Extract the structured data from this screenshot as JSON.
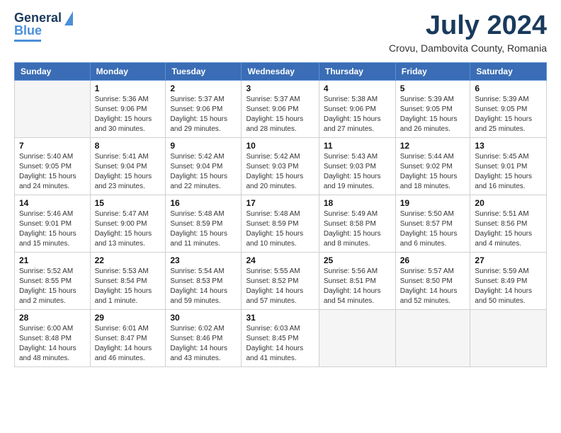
{
  "logo": {
    "line1": "General",
    "line2": "Blue"
  },
  "title": "July 2024",
  "subtitle": "Crovu, Dambovita County, Romania",
  "weekdays": [
    "Sunday",
    "Monday",
    "Tuesday",
    "Wednesday",
    "Thursday",
    "Friday",
    "Saturday"
  ],
  "weeks": [
    [
      {
        "day": "",
        "info": ""
      },
      {
        "day": "1",
        "info": "Sunrise: 5:36 AM\nSunset: 9:06 PM\nDaylight: 15 hours\nand 30 minutes."
      },
      {
        "day": "2",
        "info": "Sunrise: 5:37 AM\nSunset: 9:06 PM\nDaylight: 15 hours\nand 29 minutes."
      },
      {
        "day": "3",
        "info": "Sunrise: 5:37 AM\nSunset: 9:06 PM\nDaylight: 15 hours\nand 28 minutes."
      },
      {
        "day": "4",
        "info": "Sunrise: 5:38 AM\nSunset: 9:06 PM\nDaylight: 15 hours\nand 27 minutes."
      },
      {
        "day": "5",
        "info": "Sunrise: 5:39 AM\nSunset: 9:05 PM\nDaylight: 15 hours\nand 26 minutes."
      },
      {
        "day": "6",
        "info": "Sunrise: 5:39 AM\nSunset: 9:05 PM\nDaylight: 15 hours\nand 25 minutes."
      }
    ],
    [
      {
        "day": "7",
        "info": "Sunrise: 5:40 AM\nSunset: 9:05 PM\nDaylight: 15 hours\nand 24 minutes."
      },
      {
        "day": "8",
        "info": "Sunrise: 5:41 AM\nSunset: 9:04 PM\nDaylight: 15 hours\nand 23 minutes."
      },
      {
        "day": "9",
        "info": "Sunrise: 5:42 AM\nSunset: 9:04 PM\nDaylight: 15 hours\nand 22 minutes."
      },
      {
        "day": "10",
        "info": "Sunrise: 5:42 AM\nSunset: 9:03 PM\nDaylight: 15 hours\nand 20 minutes."
      },
      {
        "day": "11",
        "info": "Sunrise: 5:43 AM\nSunset: 9:03 PM\nDaylight: 15 hours\nand 19 minutes."
      },
      {
        "day": "12",
        "info": "Sunrise: 5:44 AM\nSunset: 9:02 PM\nDaylight: 15 hours\nand 18 minutes."
      },
      {
        "day": "13",
        "info": "Sunrise: 5:45 AM\nSunset: 9:01 PM\nDaylight: 15 hours\nand 16 minutes."
      }
    ],
    [
      {
        "day": "14",
        "info": "Sunrise: 5:46 AM\nSunset: 9:01 PM\nDaylight: 15 hours\nand 15 minutes."
      },
      {
        "day": "15",
        "info": "Sunrise: 5:47 AM\nSunset: 9:00 PM\nDaylight: 15 hours\nand 13 minutes."
      },
      {
        "day": "16",
        "info": "Sunrise: 5:48 AM\nSunset: 8:59 PM\nDaylight: 15 hours\nand 11 minutes."
      },
      {
        "day": "17",
        "info": "Sunrise: 5:48 AM\nSunset: 8:59 PM\nDaylight: 15 hours\nand 10 minutes."
      },
      {
        "day": "18",
        "info": "Sunrise: 5:49 AM\nSunset: 8:58 PM\nDaylight: 15 hours\nand 8 minutes."
      },
      {
        "day": "19",
        "info": "Sunrise: 5:50 AM\nSunset: 8:57 PM\nDaylight: 15 hours\nand 6 minutes."
      },
      {
        "day": "20",
        "info": "Sunrise: 5:51 AM\nSunset: 8:56 PM\nDaylight: 15 hours\nand 4 minutes."
      }
    ],
    [
      {
        "day": "21",
        "info": "Sunrise: 5:52 AM\nSunset: 8:55 PM\nDaylight: 15 hours\nand 2 minutes."
      },
      {
        "day": "22",
        "info": "Sunrise: 5:53 AM\nSunset: 8:54 PM\nDaylight: 15 hours\nand 1 minute."
      },
      {
        "day": "23",
        "info": "Sunrise: 5:54 AM\nSunset: 8:53 PM\nDaylight: 14 hours\nand 59 minutes."
      },
      {
        "day": "24",
        "info": "Sunrise: 5:55 AM\nSunset: 8:52 PM\nDaylight: 14 hours\nand 57 minutes."
      },
      {
        "day": "25",
        "info": "Sunrise: 5:56 AM\nSunset: 8:51 PM\nDaylight: 14 hours\nand 54 minutes."
      },
      {
        "day": "26",
        "info": "Sunrise: 5:57 AM\nSunset: 8:50 PM\nDaylight: 14 hours\nand 52 minutes."
      },
      {
        "day": "27",
        "info": "Sunrise: 5:59 AM\nSunset: 8:49 PM\nDaylight: 14 hours\nand 50 minutes."
      }
    ],
    [
      {
        "day": "28",
        "info": "Sunrise: 6:00 AM\nSunset: 8:48 PM\nDaylight: 14 hours\nand 48 minutes."
      },
      {
        "day": "29",
        "info": "Sunrise: 6:01 AM\nSunset: 8:47 PM\nDaylight: 14 hours\nand 46 minutes."
      },
      {
        "day": "30",
        "info": "Sunrise: 6:02 AM\nSunset: 8:46 PM\nDaylight: 14 hours\nand 43 minutes."
      },
      {
        "day": "31",
        "info": "Sunrise: 6:03 AM\nSunset: 8:45 PM\nDaylight: 14 hours\nand 41 minutes."
      },
      {
        "day": "",
        "info": ""
      },
      {
        "day": "",
        "info": ""
      },
      {
        "day": "",
        "info": ""
      }
    ]
  ]
}
